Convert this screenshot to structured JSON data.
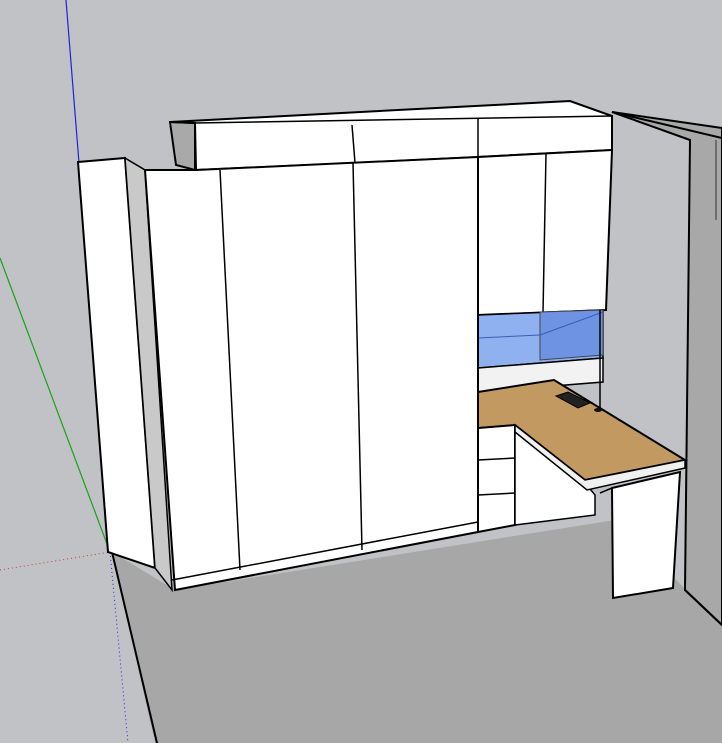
{
  "app": {
    "kind": "3d-modeling-viewport",
    "colors": {
      "sky": "#c0c2c6",
      "floor": "#a7a7a7",
      "side_wall": "#a8a8a8",
      "cabinet_face": "#ffffff",
      "cabinet_shadow": "#c9c9c9",
      "edge": "#000000",
      "glass": "#8fb1f0",
      "glass_dark": "#5f86d8",
      "desk_top": "#c29a61",
      "axis_red": "#d33",
      "axis_green": "#19a319",
      "axis_blue": "#2222dd"
    }
  },
  "scene": {
    "objects": [
      "wardrobe-tall-doors",
      "upper-cabinets",
      "glass-shelf",
      "drawer-stack",
      "l-shaped-desk",
      "desk-monitor-stand",
      "desk-leg-panel",
      "room-floor",
      "room-side-wall"
    ],
    "axes": [
      "red-axis",
      "green-axis",
      "blue-axis"
    ]
  }
}
